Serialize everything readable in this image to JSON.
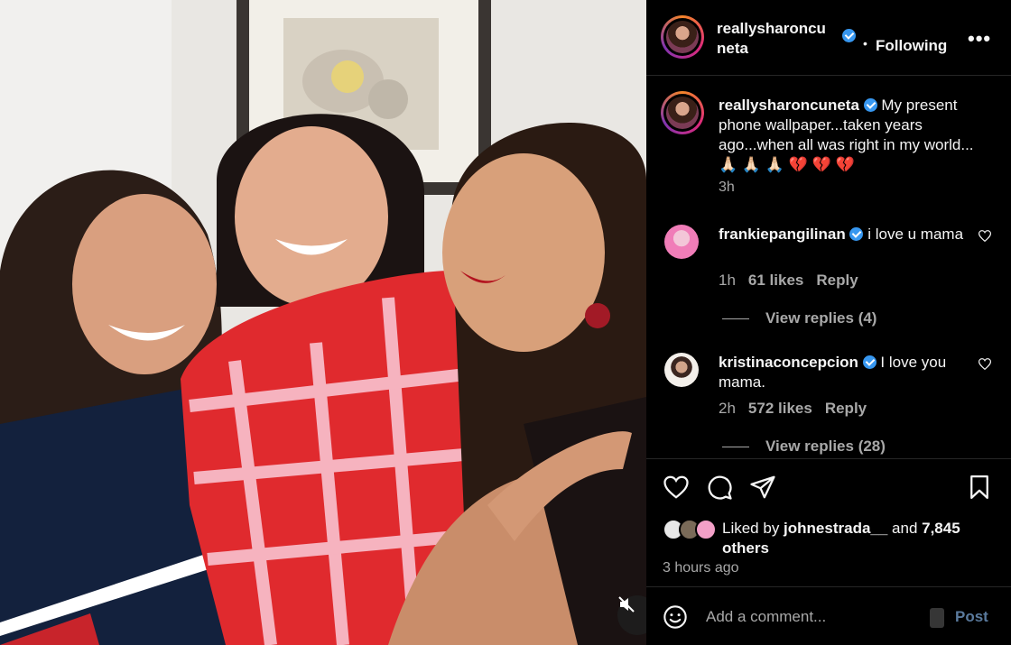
{
  "post": {
    "author": "reallysharoncuneta",
    "follow_dot": "•",
    "follow_label": "Following",
    "more_label": "•••"
  },
  "caption": {
    "username": "reallysharoncuneta",
    "text": " My present phone wallpaper...taken years ago...when all was right in my world... 🙏🏻 🙏🏻 🙏🏻 💔 💔 💔",
    "time": "3h"
  },
  "comments": [
    {
      "username": "frankiepangilinan",
      "text": " i love u mama",
      "time": "1h",
      "likes": "61 likes",
      "reply_label": "Reply",
      "view_replies": "View replies (4)",
      "avatar_color": "#f7a8d3"
    },
    {
      "username": "kristinaconcepcion",
      "text": " I love you mama.",
      "time": "2h",
      "likes": "572 likes",
      "reply_label": "Reply",
      "view_replies": "View replies (28)",
      "avatar_color": "#efe9e2"
    }
  ],
  "likes": {
    "prefix": "Liked by ",
    "user": "johnestrada__",
    "middle": " and ",
    "count": "7,845",
    "suffix": " others"
  },
  "timestamp": "3 hours ago",
  "add_comment": {
    "placeholder": "Add a comment...",
    "post_label": "Post"
  },
  "colors": {
    "verified": "#3797f0",
    "post_disabled": "#5a7a9d",
    "muted_text": "#a8a8a8"
  },
  "icons": [
    "heart-icon",
    "comment-icon",
    "share-icon",
    "bookmark-icon",
    "emoji-icon",
    "mute-icon",
    "more-icon",
    "verified-icon"
  ]
}
